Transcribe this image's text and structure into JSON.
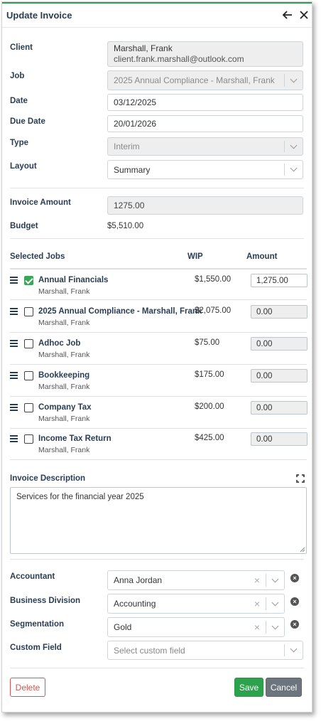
{
  "header": {
    "title": "Update Invoice"
  },
  "form": {
    "client_label": "Client",
    "client_name": "Marshall, Frank",
    "client_email": "client.frank.marshall@outlook.com",
    "job_label": "Job",
    "job_value": "2025 Annual Compliance - Marshall, Frank",
    "date_label": "Date",
    "date_value": "03/12/2025",
    "due_label": "Due Date",
    "due_value": "20/01/2026",
    "type_label": "Type",
    "type_value": "Interim",
    "layout_label": "Layout",
    "layout_value": "Summary",
    "amount_label": "Invoice Amount",
    "amount_value": "1275.00",
    "budget_label": "Budget",
    "budget_value": "$5,510.00"
  },
  "jobs_table": {
    "headers": {
      "jobs": "Selected Jobs",
      "wip": "WIP",
      "amount": "Amount"
    },
    "rows": [
      {
        "name": "Annual Financials",
        "client": "Marshall, Frank",
        "wip": "$1,550.00",
        "amount": "1,275.00",
        "checked": true
      },
      {
        "name": "2025 Annual Compliance - Marshall, Frank",
        "client": "Marshall, Frank",
        "wip": "$2,075.00",
        "amount": "0.00",
        "checked": false
      },
      {
        "name": "Adhoc Job",
        "client": "Marshall, Frank",
        "wip": "$75.00",
        "amount": "0.00",
        "checked": false
      },
      {
        "name": "Bookkeeping",
        "client": "Marshall, Frank",
        "wip": "$175.00",
        "amount": "0.00",
        "checked": false
      },
      {
        "name": "Company Tax",
        "client": "Marshall, Frank",
        "wip": "$200.00",
        "amount": "0.00",
        "checked": false
      },
      {
        "name": "Income Tax Return",
        "client": "Marshall, Frank",
        "wip": "$425.00",
        "amount": "0.00",
        "checked": false
      }
    ]
  },
  "description": {
    "label": "Invoice Description",
    "value": "Services for the financial year  2025"
  },
  "extra": {
    "accountant_label": "Accountant",
    "accountant_value": "Anna Jordan",
    "division_label": "Business Division",
    "division_value": "Accounting",
    "segmentation_label": "Segmentation",
    "segmentation_value": "Gold",
    "custom_label": "Custom Field",
    "custom_placeholder": "Select custom field"
  },
  "buttons": {
    "delete": "Delete",
    "save": "Save",
    "cancel": "Cancel"
  },
  "colors": {
    "accent": "#2e9e4f",
    "save": "#2ca24c",
    "delete": "#d9534f",
    "cancel": "#6c757d",
    "heading": "#2b3d52"
  }
}
